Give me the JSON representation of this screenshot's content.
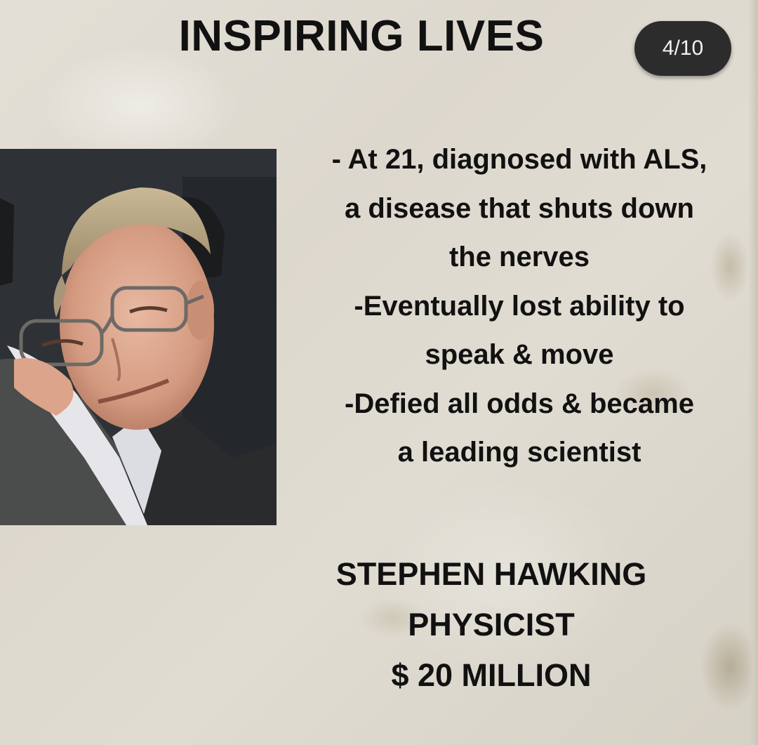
{
  "header": {
    "title": "INSPIRING LIVES",
    "page_indicator": "4/10"
  },
  "photo": {
    "subject": "portrait-photo"
  },
  "facts": [
    "- At 21, diagnosed with ALS,",
    "a disease that shuts down",
    "the nerves",
    "-Eventually lost ability to",
    "speak & move",
    "-Defied all odds & became",
    "a leading scientist"
  ],
  "profile": {
    "name": "STEPHEN HAWKING",
    "occupation": "PHYSICIST",
    "net_worth": "$ 20 MILLION"
  },
  "colors": {
    "paper": "#e0dcd2",
    "text": "#111111",
    "badge_bg": "#2c2c2c",
    "badge_text": "#f2f2f2"
  }
}
